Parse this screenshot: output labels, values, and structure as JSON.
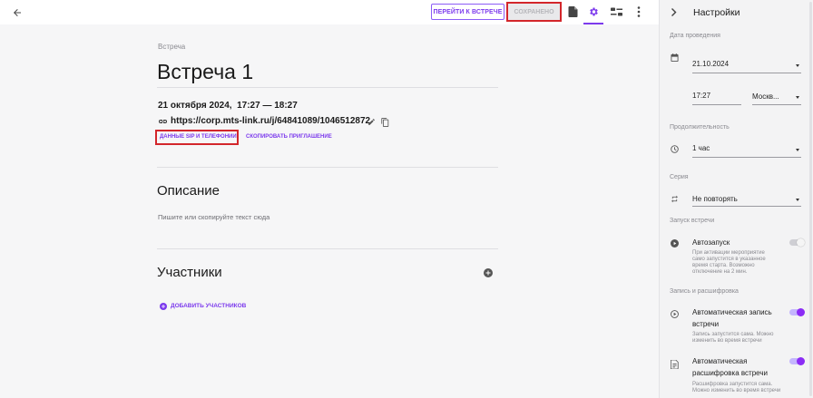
{
  "topbar": {
    "goto_meeting_label": "ПЕРЕЙТИ К ВСТРЕЧЕ",
    "saved_label": "СОХРАНЕНО"
  },
  "main": {
    "breadcrumb": "Встреча",
    "title": "Встреча 1",
    "datetime": "21 октября 2024,  17:27 — 18:27",
    "link": "https://corp.mts-link.ru/j/64841089/1046512872",
    "sip_link": "ДАННЫЕ SIP И ТЕЛЕФОНИИ",
    "copy_invite_link": "СКОПИРОВАТЬ ПРИГЛАШЕНИЕ",
    "description_heading": "Описание",
    "description_placeholder": "Пишите или скопируйте текст сюда",
    "participants_heading": "Участники",
    "add_participants_label": "ДОБАВИТЬ УЧАСТНИКОВ"
  },
  "sidebar": {
    "title": "Настройки",
    "date_section": "Дата проведения",
    "date_value": "21.10.2024",
    "time_value": "17:27",
    "timezone_value": "Москв...",
    "duration_section": "Продолжительность",
    "duration_value": "1 час",
    "series_section": "Серия",
    "series_value": "Не повторять",
    "launch_section": "Запуск встречи",
    "autolaunch_title": "Автозапуск",
    "autolaunch_desc": "При активации мероприятие само запустится в указанное время старта. Возможно отключение на 2 мин.",
    "record_section": "Запись и расшифровка",
    "autorecord_title": "Автоматическая запись встречи",
    "autorecord_desc": "Запись запустится сама. Можно изменить во время встречи",
    "autotranscribe_title": "Автоматическая расшифровка встречи",
    "autotranscribe_desc": "Расшифровка запустится сама. Можно изменить во время встречи"
  },
  "toggles": {
    "autolaunch": false,
    "autorecord": true,
    "autotranscribe": true
  },
  "colors": {
    "accent": "#7c3aed",
    "highlight": "#d3262b"
  }
}
